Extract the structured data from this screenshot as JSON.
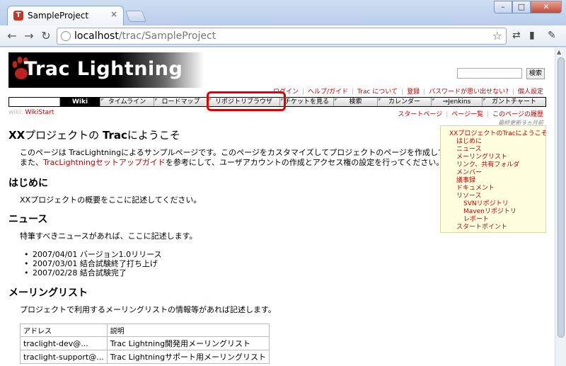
{
  "browser": {
    "tab_title": "SampleProject",
    "tab_close": "×",
    "url_host": "localhost",
    "url_path": "/trac/SampleProject",
    "window_controls": {
      "minimize": "–",
      "maximize": "□",
      "close": "✕"
    }
  },
  "header": {
    "logo_text": "Trac Lightning",
    "search_button": "検索",
    "metanav": [
      "ログイン",
      "ヘルプ/ガイド",
      "Trac について",
      "登録",
      "パスワードが思い出せない?",
      "個人設定"
    ]
  },
  "mainnav": {
    "items": [
      "Wiki",
      "タイムライン",
      "ロードマップ",
      "リポジトリブラウザ",
      "チケットを見る",
      "検索",
      "カレンダー",
      "Jenkins",
      "ガントチャート"
    ],
    "active_index": 0,
    "highlighted_index": 3
  },
  "breadcrumb": {
    "label": "wiki:",
    "page": "WikiStart"
  },
  "ctxtnav": [
    "スタートページ",
    "ページ一覧",
    "このページの履歴"
  ],
  "last_modified": "最終更新 9ヵ月前",
  "content": {
    "title_a": "XX",
    "title_b": "プロジェクトの ",
    "title_c": "Trac",
    "title_d": "にようこそ",
    "intro_line1": "このページは TracLightningによるサンプルページです。このページをカスタマイズしてプロジェクトのページを作成してください。",
    "intro_line2_pre": "また、",
    "intro_line2_link": "TracLightningセットアップガイド",
    "intro_line2_post": "を参考にして、ユーザアカウントの作成とアクセス権の設定を行ってください。",
    "h_hajime": "はじめに",
    "p_hajime": "XXプロジェクトの概要をここに記述してください。",
    "h_news": "ニュース",
    "p_news": "特筆すべきニュースがあれば、ここに記述します。",
    "news_items": [
      "2007/04/01 バージョン1.0リリース",
      "2007/03/01 結合試験終了打ち上げ",
      "2007/02/28 結合試験完了"
    ],
    "h_ml": "メーリングリスト",
    "p_ml": "プロジェクトで利用するメーリングリストの情報等があれば記述します。",
    "ml_table": {
      "headers": [
        "アドレス",
        "説明"
      ],
      "rows": [
        [
          "traclight-dev@...",
          "Trac Lightning開発用メーリングリスト"
        ],
        [
          "traclight-support@...",
          "Trac Lightningサポート用メーリングリスト"
        ]
      ]
    }
  },
  "toc": [
    {
      "label": "XXプロジェクトのTracにようこそ",
      "level": 1
    },
    {
      "label": "はじめに",
      "level": 2
    },
    {
      "label": "ニュース",
      "level": 2
    },
    {
      "label": "メーリングリスト",
      "level": 2
    },
    {
      "label": "リンク、共有フォルダ",
      "level": 2
    },
    {
      "label": "メンバー",
      "level": 2
    },
    {
      "label": "議事録",
      "level": 2
    },
    {
      "label": "ドキュメント",
      "level": 2
    },
    {
      "label": "リソース",
      "level": 2
    },
    {
      "label": "SVNリポジトリ",
      "level": 3
    },
    {
      "label": "Mavenリポジトリ",
      "level": 3
    },
    {
      "label": "レポート",
      "level": 3
    },
    {
      "label": "スタートポイント",
      "level": 2
    }
  ]
}
